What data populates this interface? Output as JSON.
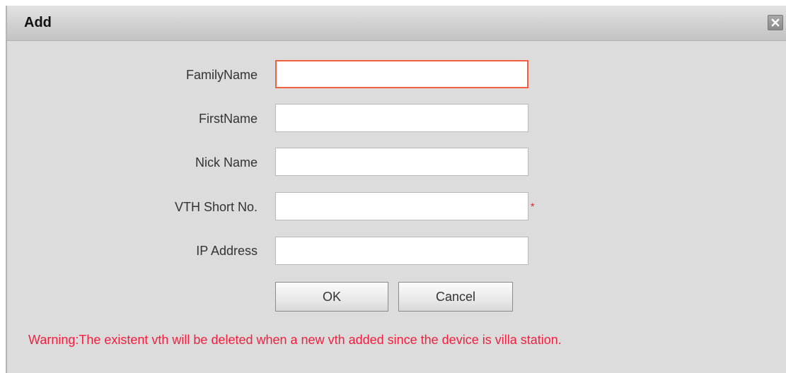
{
  "dialog": {
    "title": "Add",
    "close_icon": "close-icon"
  },
  "form": {
    "fields": [
      {
        "label": "FamilyName",
        "value": "",
        "placeholder": "",
        "focused": true
      },
      {
        "label": "FirstName",
        "value": "",
        "placeholder": ""
      },
      {
        "label": "Nick Name",
        "value": "",
        "placeholder": ""
      },
      {
        "label": "VTH Short No.",
        "value": "",
        "placeholder": "",
        "required_marker": "*"
      },
      {
        "label": "IP Address",
        "value": "",
        "placeholder": ""
      }
    ]
  },
  "buttons": {
    "ok_label": "OK",
    "cancel_label": "Cancel"
  },
  "warning": {
    "text": "Warning:The existent vth will be deleted when a new vth added since the device is villa station."
  },
  "colors": {
    "focus_border": "#f2603f",
    "warning_text": "#f0203e",
    "required_marker": "#e02020",
    "dialog_background": "#dcdcdc"
  }
}
